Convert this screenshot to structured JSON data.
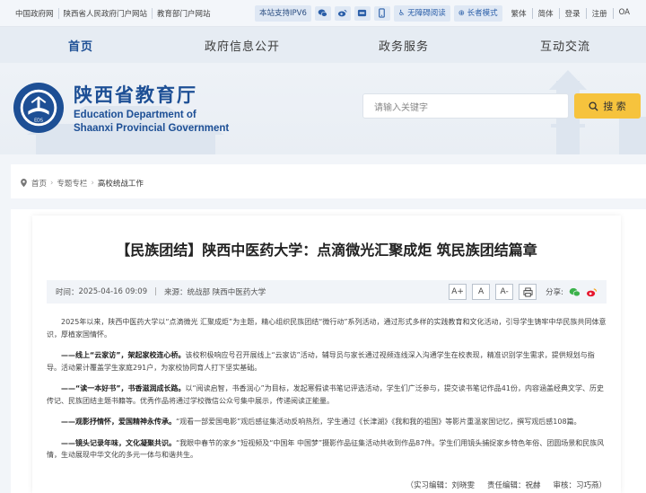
{
  "topbar": {
    "links": [
      "中国政府网",
      "陕西省人民政府门户网站",
      "教育部门户网站"
    ],
    "ipv6": "本站支持IPV6",
    "accessible": "无障碍阅读",
    "elder": "长者模式",
    "lang": [
      "繁体",
      "简体",
      "登录",
      "注册",
      "OA"
    ]
  },
  "nav": [
    "首页",
    "政府信息公开",
    "政务服务",
    "互动交流"
  ],
  "header": {
    "title_cn": "陕西省教育厅",
    "title_en_1": "Education Department of",
    "title_en_2": "Shaanxi Provincial Government",
    "emblem_text": "EDS",
    "search_placeholder": "请输入关键字",
    "search_button": "搜 索"
  },
  "breadcrumb": [
    "首页",
    "专题专栏",
    "高校统战工作"
  ],
  "article": {
    "title": "【民族团结】陕西中医药大学：点滴微光汇聚成炬 筑民族团结篇章",
    "time_label": "时间：",
    "time": "2025-04-16 09:09",
    "source_label": "来源：",
    "source": "统战部 陕西中医药大学",
    "font_buttons": [
      "A+",
      "A",
      "A-"
    ],
    "share_label": "分享:",
    "paragraphs": [
      {
        "lead": "",
        "text": "2025年以来，陕西中医药大学以“点滴微光 汇聚成炬”为主题，精心组织民族团结“微行动”系列活动，通过形式多样的实践教育和文化活动，引导学生铸牢中华民族共同体意识，厚植家国情怀。"
      },
      {
        "lead": "——线上“云家访”，架起家校连心桥。",
        "text": "该校积极响应号召开展线上“云家访”活动，辅导员与家长通过视频连线深入沟通学生在校表现，精准识别学生需求，提供规划与指导。活动累计覆盖学生家庭291户，为家校协同育人打下坚实基础。"
      },
      {
        "lead": "——“读一本好书”，书香滋润成长路。",
        "text": "以“阅读启智，书香润心”为目标，发起寒假读书笔记评选活动，学生们广泛参与，提交读书笔记作品41份，内容涵盖经典文学、历史传记、民族团结主题书籍等。优秀作品将通过学校微信公众号集中展示，传递阅读正能量。"
      },
      {
        "lead": "——观影抒情怀，爱国精神永传承。",
        "text": "“观看一部爱国电影”观后感征集活动反响热烈，学生通过《长津湖》《我和我的祖国》等影片重温家国记忆，撰写观后感108篇。"
      },
      {
        "lead": "——镜头记录年味，文化凝聚共识。",
        "text": "“我眼中春节的家乡”短视频及“中国年 中国梦”摄影作品征集活动共收到作品87件。学生们用镜头捕捉家乡特色年俗、团圆场景和民族风情，生动展现中华文化的多元一体与和谐共生。"
      }
    ],
    "intern_editor": "（实习编辑：刘晓雯",
    "editor": "责任编辑：祝赫",
    "reviewer": "审核：习巧燕）"
  },
  "colors": {
    "brand": "#1d4f95",
    "accent": "#f6c33d"
  }
}
